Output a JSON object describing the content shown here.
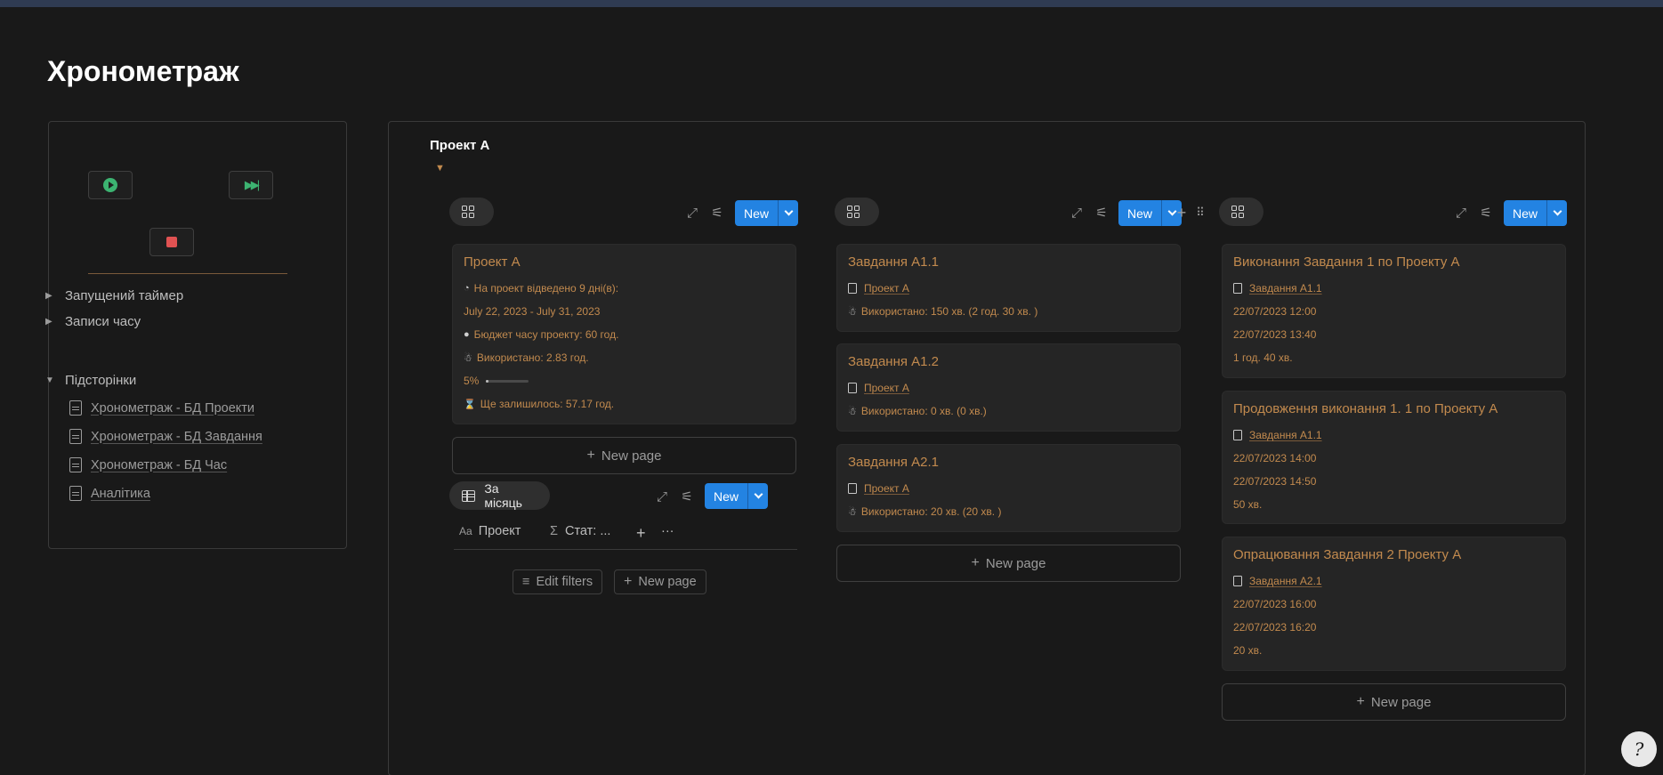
{
  "page": {
    "title": "Хронометраж"
  },
  "left_panel": {
    "toggles": [
      {
        "label": "Запущений таймер",
        "open": false
      },
      {
        "label": "Записи часу",
        "open": false
      },
      {
        "label": "Підсторінки",
        "open": true
      }
    ],
    "subpages": [
      "Хронометраж - БД Проекти",
      "Хронометраж - БД Завдання",
      "Хронометраж - БД Час",
      "Аналітика"
    ]
  },
  "right_panel": {
    "title": "Проект A",
    "new_label": "New",
    "new_page_label": "New page",
    "projects_board": {
      "card": {
        "title": "Проект А",
        "allocated": "На проект відведено  9 дні(в):",
        "dates": "July 22, 2023 - July 31, 2023",
        "budget": "Бюджет часу проекту: 60 год.",
        "used": "Використано: 2.83 год.",
        "progress_label": "5%",
        "progress_value": 0.05,
        "remaining": "Ще залишилось: 57.17 год."
      }
    },
    "monthly_table": {
      "view_label": "За місяць",
      "columns": [
        "Проект",
        "Стат: ..."
      ],
      "edit_filters": "Edit filters"
    },
    "tasks_board": {
      "cards": [
        {
          "title": "Завдання A1.1",
          "project": "Проект А",
          "used": "Використано: 150 хв. (2 год. 30 хв. )"
        },
        {
          "title": "Завдання A1.2",
          "project": "Проект А",
          "used": "Використано: 0 хв. (0 хв.)"
        },
        {
          "title": "Завдання A2.1",
          "project": "Проект А",
          "used": "Використано: 20 хв. (20 хв. )"
        }
      ]
    },
    "time_board": {
      "cards": [
        {
          "title": "Виконання Завдання 1 по Проекту A",
          "task": "Завдання A1.1",
          "start": "22/07/2023 12:00",
          "end": "22/07/2023 13:40",
          "duration": "1 год. 40 хв."
        },
        {
          "title": "Продовження виконання 1. 1 по Проекту A",
          "task": "Завдання A1.1",
          "start": "22/07/2023 14:00",
          "end": "22/07/2023 14:50",
          "duration": "50 хв."
        },
        {
          "title": "Опрацювання Завдання 2 Проекту A",
          "task": "Завдання A2.1",
          "start": "22/07/2023 16:00",
          "end": "22/07/2023 16:20",
          "duration": "20 хв."
        }
      ]
    }
  },
  "icons": {
    "play": "play-icon",
    "skip": "skip-forward-icon",
    "stop": "stop-icon",
    "gallery": "gallery-view-icon",
    "expand": "expand-icon",
    "settings": "sliders-icon",
    "table": "table-view-icon",
    "help": "help-icon"
  },
  "colors": {
    "accent": "#2383e2",
    "card_text": "#c28a4e",
    "background": "#191919"
  }
}
